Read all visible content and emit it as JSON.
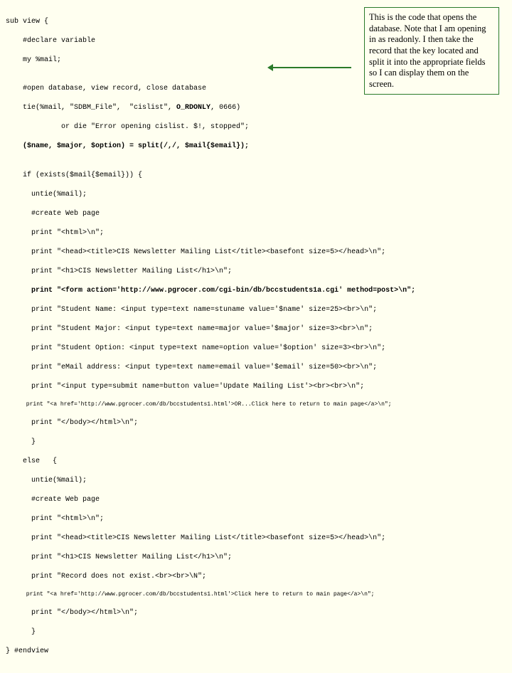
{
  "callout": "This is the code that opens the database.  Note that I am opening in as readonly.  I then take the record that the key located and split it into the appropriate fields so I can display them on the screen.",
  "code": {
    "l01": "sub view {",
    "l02": "    #declare variable",
    "l03": "    my %mail;",
    "l04": "",
    "l05": "    #open database, view record, close database",
    "l06_a": "    tie(%mail, \"SDBM_File\",  \"cislist\", ",
    "l06_b": "O_RDONLY",
    "l06_c": ", 0666)",
    "l07": "             or die \"Error opening cislist. $!, stopped\";",
    "l08": "    ($name, $major, $option) = split(/,/, $mail{$email});",
    "l09": "",
    "l10": "    if (exists($mail{$email})) {",
    "l11": "      untie(%mail);",
    "l12": "      #create Web page",
    "l13": "      print \"<html>\\n\";",
    "l14": "      print \"<head><title>CIS Newsletter Mailing List</title><basefont size=5></head>\\n\";",
    "l15": "      print \"<h1>CIS Newsletter Mailing List</h1>\\n\";",
    "l16": "      print \"<form action='http://www.pgrocer.com/cgi-bin/db/bccstudents1a.cgi' method=post>\\n\";",
    "l17": "      print \"Student Name: <input type=text name=stuname value='$name' size=25><br>\\n\";",
    "l18": "      print \"Student Major: <input type=text name=major value='$major' size=3><br>\\n\";",
    "l19": "      print \"Student Option: <input type=text name=option value='$option' size=3><br>\\n\";",
    "l20": "      print \"eMail address: <input type=text name=email value='$email' size=50><br>\\n\";",
    "l21": "      print \"<input type=submit name=button value='Update Mailing List'><br><br>\\n\";",
    "l22": "      print \"<a href='http://www.pgrocer.com/db/bccstudents1.html'>OR...Click here to return to main page</a>\\n\";",
    "l23": "      print \"</body></html>\\n\";",
    "l24": "      }",
    "l25": "    else   {",
    "l26": "      untie(%mail);",
    "l27": "      #create Web page",
    "l28": "      print \"<html>\\n\";",
    "l29": "      print \"<head><title>CIS Newsletter Mailing List</title><basefont size=5></head>\\n\";",
    "l30": "      print \"<h1>CIS Newsletter Mailing List</h1>\\n\";",
    "l31": "      print \"Record does not exist.<br><br>\\N\";",
    "l32": "      print \"<a href='http://www.pgrocer.com/db/bccstudents1.html'>Click here to return to main page</a>\\n\";",
    "l33": "      print \"</body></html>\\n\";",
    "l34": "      }",
    "l35": "} #endview"
  }
}
